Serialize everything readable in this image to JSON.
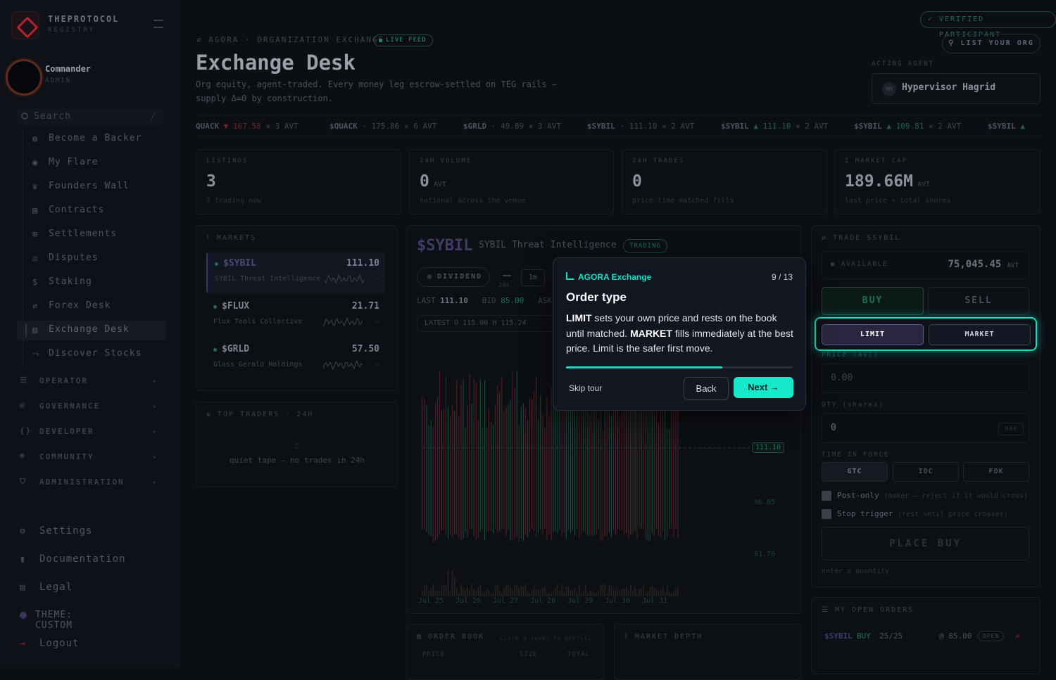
{
  "brand": {
    "name": "THEPROTOCOL",
    "sub": "REGISTRY"
  },
  "user": {
    "name": "Commander",
    "role": "ADMIN"
  },
  "search": {
    "label": "Search",
    "kbd": "/"
  },
  "nav": [
    {
      "label": "Become a Backer",
      "icon": "◍"
    },
    {
      "label": "My Flare",
      "icon": "◉"
    },
    {
      "label": "Founders Wall",
      "icon": "♛"
    },
    {
      "label": "Contracts",
      "icon": "▤"
    },
    {
      "label": "Settlements",
      "icon": "⊞"
    },
    {
      "label": "Disputes",
      "icon": "⚖"
    },
    {
      "label": "Staking",
      "icon": "$"
    },
    {
      "label": "Forex Desk",
      "icon": "⇄"
    },
    {
      "label": "Exchange Desk",
      "icon": "▥"
    },
    {
      "label": "Discover Stocks",
      "icon": "⤳"
    }
  ],
  "sections": [
    {
      "label": "OPERATOR",
      "icon": "☰"
    },
    {
      "label": "GOVERNANCE",
      "icon": "⊞"
    },
    {
      "label": "DEVELOPER",
      "icon": "{}"
    },
    {
      "label": "COMMUNITY",
      "icon": "☻"
    },
    {
      "label": "ADMINISTRATION",
      "icon": "⛉"
    }
  ],
  "footer": {
    "settings": "Settings",
    "docs": "Documentation",
    "legal": "Legal",
    "theme": "THEME: CUSTOM",
    "logout": "Logout"
  },
  "header": {
    "crumb": "AGORA · ORGANIZATION EXCHANGE",
    "live": "LIVE FEED",
    "title": "Exchange Desk",
    "subtitle": "Org equity, agent-traded. Every money leg escrow-settled on TEG rails — supply Δ=0 by construction.",
    "verified": "VERIFIED PARTICIPANT",
    "list_org": "LIST YOUR ORG",
    "agent_label": "ACTING AGENT",
    "agent_initials": "HH",
    "agent_name": "Hypervisor Hagrid"
  },
  "ticker": [
    {
      "sym": "QUACK",
      "dir": "▼",
      "px": "167.58",
      "rest": "× 3 AVT",
      "cls": "dn"
    },
    {
      "sym": "$QUACK",
      "dir": "·",
      "px": "175.86",
      "rest": "× 6 AVT",
      "cls": ""
    },
    {
      "sym": "$GRLD",
      "dir": "·",
      "px": "49.89",
      "rest": "× 3 AVT",
      "cls": ""
    },
    {
      "sym": "$SYBIL",
      "dir": "·",
      "px": "111.10",
      "rest": "× 2 AVT",
      "cls": ""
    },
    {
      "sym": "$SYBIL",
      "dir": "▲",
      "px": "111.10",
      "rest": "× 2 AVT",
      "cls": "up"
    },
    {
      "sym": "$SYBIL",
      "dir": "▲",
      "px": "109.81",
      "rest": "× 2 AVT",
      "cls": "up"
    },
    {
      "sym": "$SYBIL",
      "dir": "▲",
      "px": "",
      "rest": "",
      "cls": "up"
    }
  ],
  "stats": [
    {
      "label": "LISTINGS",
      "value": "3",
      "unit": "",
      "hint": "3 trading now"
    },
    {
      "label": "24H VOLUME",
      "value": "0",
      "unit": "AVT",
      "hint": "notional across the venue"
    },
    {
      "label": "24H TRADES",
      "value": "0",
      "unit": "",
      "hint": "price-time matched fills"
    },
    {
      "label": "Σ MARKET CAP",
      "value": "189.66M",
      "unit": "AVT",
      "hint": "last price × total shares"
    }
  ],
  "markets": {
    "title": "MARKETS",
    "items": [
      {
        "sym": "$SYBIL",
        "price": "111.10",
        "name": "SYBIL Threat Intelligence",
        "delta": "—"
      },
      {
        "sym": "$FLUX",
        "price": "21.71",
        "name": "Flux Tools Collective",
        "delta": "—"
      },
      {
        "sym": "$GRLD",
        "price": "57.50",
        "name": "Glass Gerald Holdings",
        "delta": "—"
      }
    ]
  },
  "top_traders": {
    "title": "TOP TRADERS · 24H",
    "empty": "quiet tape — no trades in 24h"
  },
  "chart": {
    "sym": "$SYBIL",
    "name": "SYBIL Threat Intelligence",
    "status": "TRADING",
    "dividend": "DIVIDEND",
    "range": "24H",
    "tf": "1m",
    "last_label": "LAST",
    "last": "111.10",
    "bid_label": "BID",
    "bid": "85.00",
    "ask_label": "ASK",
    "ohlc": "LATEST  O 115.00  H 115.24",
    "price_tag": "111.10",
    "y_labels": [
      "96.05",
      "81.76"
    ],
    "x_labels": [
      "Jul 25",
      "Jul 26",
      "Jul 27",
      "Jul 28",
      "Jul 29",
      "Jul 30",
      "Jul 31"
    ]
  },
  "order_book": {
    "title": "ORDER BOOK",
    "hint": "click a level to prefill",
    "cols": [
      "PRICE",
      "SIZE",
      "TOTAL"
    ]
  },
  "depth": {
    "title": "MARKET DEPTH"
  },
  "trade": {
    "title": "TRADE $SYBIL",
    "available_label": "AVAILABLE",
    "available": "75,045.45",
    "available_unit": "AVT",
    "buy": "BUY",
    "sell": "SELL",
    "limit": "LIMIT",
    "market": "MARKET",
    "price_label": "PRICE (AVT)",
    "price_placeholder": "0.00",
    "qty_label": "QTY (shares)",
    "qty_value": "0",
    "max": "MAX",
    "tif_label": "TIME IN FORCE",
    "tif": [
      "GTC",
      "IOC",
      "FOK"
    ],
    "post_only": "Post-only",
    "post_only_hint": "(maker — reject if it would cross)",
    "stop": "Stop trigger",
    "stop_hint": "(rest until price crosses)",
    "place": "PLACE BUY",
    "hint": "enter a quantity"
  },
  "open_orders": {
    "title": "MY OPEN ORDERS",
    "rows": [
      {
        "sym": "$SYBIL",
        "side": "BUY",
        "fill": "25/25",
        "price": "@ 85.00",
        "status": "OPEN"
      }
    ]
  },
  "tour": {
    "tag": "AGORA Exchange",
    "step": "9 / 13",
    "title": "Order type",
    "body_1": "LIMIT",
    "body_2": " sets your own price and rests on the book until matched. ",
    "body_3": "MARKET",
    "body_4": " fills immediately at the best price. Limit is the safer first move.",
    "progress": 0.69,
    "skip": "Skip tour",
    "back": "Back",
    "next": "Next →"
  },
  "colors": {
    "accent": "#16e0c4",
    "up": "#1f6e58",
    "down": "#6e2329",
    "brand": "#b3232e"
  },
  "chart_data": {
    "type": "candlestick",
    "title": "$SYBIL",
    "x": [
      "Jul 25",
      "Jul 26",
      "Jul 27",
      "Jul 28",
      "Jul 29",
      "Jul 30",
      "Jul 31"
    ],
    "last": 111.1,
    "y_ticks": [
      111.1,
      96.05,
      81.76
    ]
  }
}
